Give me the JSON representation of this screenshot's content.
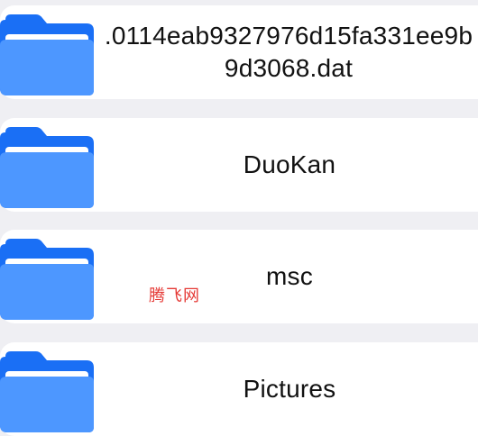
{
  "files": [
    {
      "name": ".0114eab9327976d15fa331ee9b9d3068.dat",
      "type": "folder",
      "icon": "folder-icon"
    },
    {
      "name": "DuoKan",
      "type": "folder",
      "icon": "folder-icon"
    },
    {
      "name": "msc",
      "type": "folder",
      "icon": "folder-icon"
    },
    {
      "name": "Pictures",
      "type": "folder",
      "icon": "folder-icon"
    }
  ],
  "watermark": "腾飞网",
  "colors": {
    "background": "#efeff3",
    "card": "#ffffff",
    "folder_back": "#1a6ff5",
    "folder_front": "#4d97ff",
    "folder_paper": "#ffffff",
    "text": "#111111",
    "watermark": "#e53935"
  }
}
